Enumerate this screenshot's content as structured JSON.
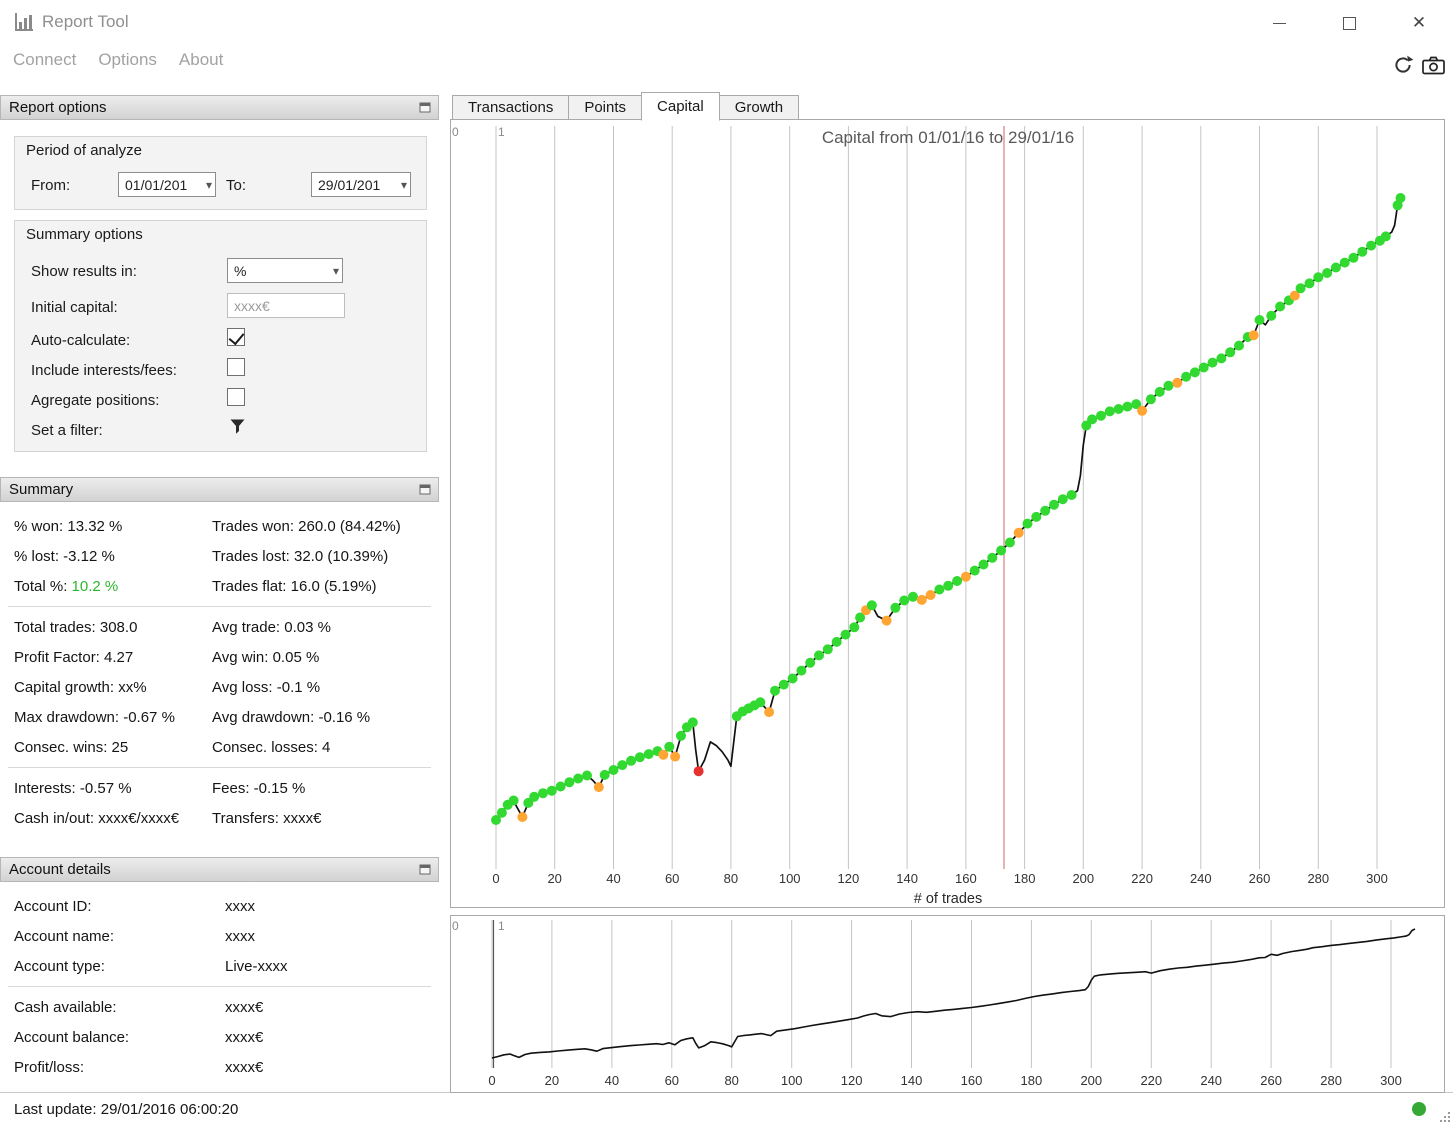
{
  "titlebar": {
    "title": "Report Tool"
  },
  "menubar": {
    "items": [
      {
        "label": "Connect"
      },
      {
        "label": "Options"
      },
      {
        "label": "About"
      }
    ]
  },
  "report_options": {
    "header": "Report options",
    "period": {
      "legend": "Period of analyze",
      "from_label": "From:",
      "from_value": "01/01/201",
      "to_label": "To:",
      "to_value": "29/01/201"
    },
    "options": {
      "legend": "Summary options",
      "show_results_label": "Show results in:",
      "show_results_value": "%",
      "initial_capital_label": "Initial capital:",
      "initial_capital_value": "xxxx€",
      "auto_calculate_label": "Auto-calculate:",
      "auto_calculate_checked": true,
      "include_fees_label": "Include interests/fees:",
      "include_fees_checked": false,
      "agregate_label": "Agregate positions:",
      "agregate_checked": false,
      "filter_label": "Set a filter:"
    }
  },
  "summary": {
    "header": "Summary",
    "accent_color": "#2db52d",
    "groups": [
      {
        "rows": [
          [
            "% won: 13.32 %",
            "Trades won: 260.0 (84.42%)"
          ],
          [
            "% lost: -3.12 %",
            "Trades lost: 32.0 (10.39%)"
          ],
          [
            {
              "text": "Total %: ",
              "accent": "10.2 %"
            },
            "Trades flat: 16.0 (5.19%)"
          ]
        ]
      },
      {
        "rows": [
          [
            "Total trades: 308.0",
            "Avg trade: 0.03 %"
          ],
          [
            "Profit Factor: 4.27",
            "Avg win: 0.05 %"
          ],
          [
            "Capital growth: xx%",
            "Avg loss: -0.1 %"
          ],
          [
            "Max drawdown: -0.67 %",
            "Avg drawdown: -0.16 %"
          ],
          [
            "Consec. wins: 25",
            "Consec. losses: 4"
          ]
        ]
      },
      {
        "rows": [
          [
            "Interests: -0.57 %",
            "Fees: -0.15 %"
          ],
          [
            "Cash in/out: xxxx€/xxxx€",
            "Transfers: xxxx€"
          ]
        ]
      }
    ]
  },
  "account": {
    "header": "Account details",
    "groups": [
      {
        "rows": [
          [
            "Account ID:",
            "xxxx"
          ],
          [
            "Account name:",
            "xxxx"
          ],
          [
            "Account type:",
            "Live-xxxx"
          ]
        ]
      },
      {
        "rows": [
          [
            "Cash available:",
            "xxxx€"
          ],
          [
            "Account balance:",
            "xxxx€"
          ],
          [
            "Profit/loss:",
            "xxxx€"
          ]
        ]
      }
    ]
  },
  "statusbar": {
    "last_update": "Last update: 29/01/2016 06:00:20",
    "status_color": "#35a835"
  },
  "tabs": {
    "items": [
      {
        "label": "Transactions",
        "active": false
      },
      {
        "label": "Points",
        "active": false
      },
      {
        "label": "Capital",
        "active": true
      },
      {
        "label": "Growth",
        "active": false
      }
    ]
  },
  "chart_data": [
    {
      "type": "line",
      "title": "Capital from 01/01/16 to 29/01/16",
      "xlabel": "# of trades",
      "ylabel": "",
      "x_ticks": [
        0,
        20,
        40,
        60,
        80,
        100,
        120,
        140,
        160,
        180,
        200,
        220,
        240,
        260,
        280,
        300
      ],
      "xlim": [
        0,
        300
      ],
      "ylim": [
        0,
        10.2
      ],
      "grid": true,
      "legend": "none",
      "cursor_x": 173,
      "cursor_color": "#cc6666",
      "corner_labels": [
        "0",
        "1"
      ],
      "line_color": "#111111",
      "marker_colors": {
        "g": "#31d931",
        "o": "#ffa533",
        "r": "#e8312f"
      },
      "series": [
        {
          "name": "capital",
          "points": [
            [
              0,
              0.0,
              "g"
            ],
            [
              2,
              0.12,
              "g"
            ],
            [
              4,
              0.25,
              "g"
            ],
            [
              6,
              0.32,
              "g"
            ],
            [
              7,
              0.22,
              ""
            ],
            [
              9,
              0.05,
              "o"
            ],
            [
              11,
              0.28,
              "g"
            ],
            [
              13,
              0.38,
              "g"
            ],
            [
              16,
              0.44,
              "g"
            ],
            [
              19,
              0.48,
              "g"
            ],
            [
              22,
              0.55,
              "g"
            ],
            [
              25,
              0.62,
              "g"
            ],
            [
              28,
              0.68,
              "g"
            ],
            [
              31,
              0.73,
              "g"
            ],
            [
              33,
              0.65,
              ""
            ],
            [
              35,
              0.54,
              "o"
            ],
            [
              37,
              0.74,
              "g"
            ],
            [
              40,
              0.82,
              "g"
            ],
            [
              43,
              0.9,
              "g"
            ],
            [
              46,
              0.97,
              "g"
            ],
            [
              49,
              1.03,
              "g"
            ],
            [
              52,
              1.08,
              "g"
            ],
            [
              55,
              1.13,
              "g"
            ],
            [
              57,
              1.07,
              "o"
            ],
            [
              59,
              1.2,
              "g"
            ],
            [
              61,
              1.04,
              "o"
            ],
            [
              63,
              1.38,
              "g"
            ],
            [
              65,
              1.52,
              "g"
            ],
            [
              67,
              1.6,
              "g"
            ],
            [
              68,
              1.15,
              ""
            ],
            [
              69,
              0.8,
              "r"
            ],
            [
              71,
              0.98,
              ""
            ],
            [
              73,
              1.28,
              ""
            ],
            [
              75,
              1.22,
              ""
            ],
            [
              77,
              1.12,
              ""
            ],
            [
              79,
              0.98,
              ""
            ],
            [
              80,
              0.88,
              ""
            ],
            [
              81,
              1.3,
              ""
            ],
            [
              82,
              1.7,
              "g"
            ],
            [
              84,
              1.78,
              "g"
            ],
            [
              86,
              1.83,
              "g"
            ],
            [
              88,
              1.88,
              "g"
            ],
            [
              90,
              1.93,
              "g"
            ],
            [
              93,
              1.77,
              "o"
            ],
            [
              95,
              2.12,
              "g"
            ],
            [
              98,
              2.22,
              "g"
            ],
            [
              101,
              2.32,
              "g"
            ],
            [
              104,
              2.45,
              "g"
            ],
            [
              107,
              2.58,
              "g"
            ],
            [
              110,
              2.7,
              "g"
            ],
            [
              113,
              2.8,
              "g"
            ],
            [
              116,
              2.92,
              "g"
            ],
            [
              119,
              3.04,
              "g"
            ],
            [
              122,
              3.16,
              "g"
            ],
            [
              124,
              3.32,
              "g"
            ],
            [
              126,
              3.44,
              "o"
            ],
            [
              128,
              3.52,
              "g"
            ],
            [
              130,
              3.34,
              ""
            ],
            [
              133,
              3.27,
              "o"
            ],
            [
              136,
              3.48,
              "g"
            ],
            [
              139,
              3.6,
              "g"
            ],
            [
              142,
              3.66,
              "g"
            ],
            [
              145,
              3.61,
              "o"
            ],
            [
              148,
              3.69,
              "o"
            ],
            [
              151,
              3.78,
              "g"
            ],
            [
              154,
              3.84,
              "g"
            ],
            [
              157,
              3.92,
              "g"
            ],
            [
              160,
              3.99,
              "o"
            ],
            [
              163,
              4.09,
              "g"
            ],
            [
              166,
              4.19,
              "g"
            ],
            [
              169,
              4.3,
              "g"
            ],
            [
              172,
              4.42,
              "g"
            ],
            [
              175,
              4.55,
              "g"
            ],
            [
              178,
              4.71,
              "o"
            ],
            [
              181,
              4.86,
              "g"
            ],
            [
              184,
              4.97,
              "g"
            ],
            [
              187,
              5.07,
              "g"
            ],
            [
              190,
              5.17,
              "g"
            ],
            [
              193,
              5.26,
              "g"
            ],
            [
              196,
              5.33,
              "g"
            ],
            [
              198,
              5.4,
              ""
            ],
            [
              199,
              5.65,
              ""
            ],
            [
              200,
              6.15,
              ""
            ],
            [
              201,
              6.47,
              "g"
            ],
            [
              203,
              6.57,
              "g"
            ],
            [
              206,
              6.63,
              "g"
            ],
            [
              209,
              6.7,
              "g"
            ],
            [
              212,
              6.74,
              "g"
            ],
            [
              215,
              6.78,
              "g"
            ],
            [
              218,
              6.82,
              "g"
            ],
            [
              220,
              6.71,
              "o"
            ],
            [
              223,
              6.9,
              "g"
            ],
            [
              226,
              7.02,
              "g"
            ],
            [
              229,
              7.12,
              "g"
            ],
            [
              232,
              7.17,
              "o"
            ],
            [
              235,
              7.27,
              "g"
            ],
            [
              238,
              7.34,
              "g"
            ],
            [
              241,
              7.42,
              "g"
            ],
            [
              244,
              7.5,
              "g"
            ],
            [
              247,
              7.57,
              "g"
            ],
            [
              250,
              7.67,
              "g"
            ],
            [
              253,
              7.78,
              "g"
            ],
            [
              256,
              7.92,
              "g"
            ],
            [
              258,
              7.95,
              "o"
            ],
            [
              260,
              8.2,
              "g"
            ],
            [
              262,
              8.12,
              ""
            ],
            [
              264,
              8.27,
              "g"
            ],
            [
              267,
              8.42,
              "g"
            ],
            [
              270,
              8.52,
              "g"
            ],
            [
              272,
              8.6,
              "o"
            ],
            [
              274,
              8.72,
              "g"
            ],
            [
              277,
              8.8,
              "g"
            ],
            [
              280,
              8.9,
              "g"
            ],
            [
              283,
              8.97,
              "g"
            ],
            [
              286,
              9.06,
              "g"
            ],
            [
              289,
              9.14,
              "g"
            ],
            [
              292,
              9.22,
              "g"
            ],
            [
              295,
              9.32,
              "g"
            ],
            [
              298,
              9.42,
              "g"
            ],
            [
              301,
              9.5,
              "g"
            ],
            [
              303,
              9.57,
              "g"
            ],
            [
              305,
              9.64,
              ""
            ],
            [
              306,
              9.75,
              ""
            ],
            [
              307,
              10.08,
              "g"
            ],
            [
              308,
              10.2,
              "g"
            ]
          ]
        }
      ]
    },
    {
      "type": "line",
      "title": "",
      "xlabel": "",
      "x_ticks": [
        0,
        20,
        40,
        60,
        80,
        100,
        120,
        140,
        160,
        180,
        200,
        220,
        240,
        260,
        280,
        300
      ],
      "xlim": [
        0,
        300
      ],
      "ylim": [
        0,
        10.2
      ],
      "grid": true,
      "corner_labels": [
        "0",
        "1"
      ],
      "line_color": "#111111",
      "series_ref": 0
    }
  ]
}
